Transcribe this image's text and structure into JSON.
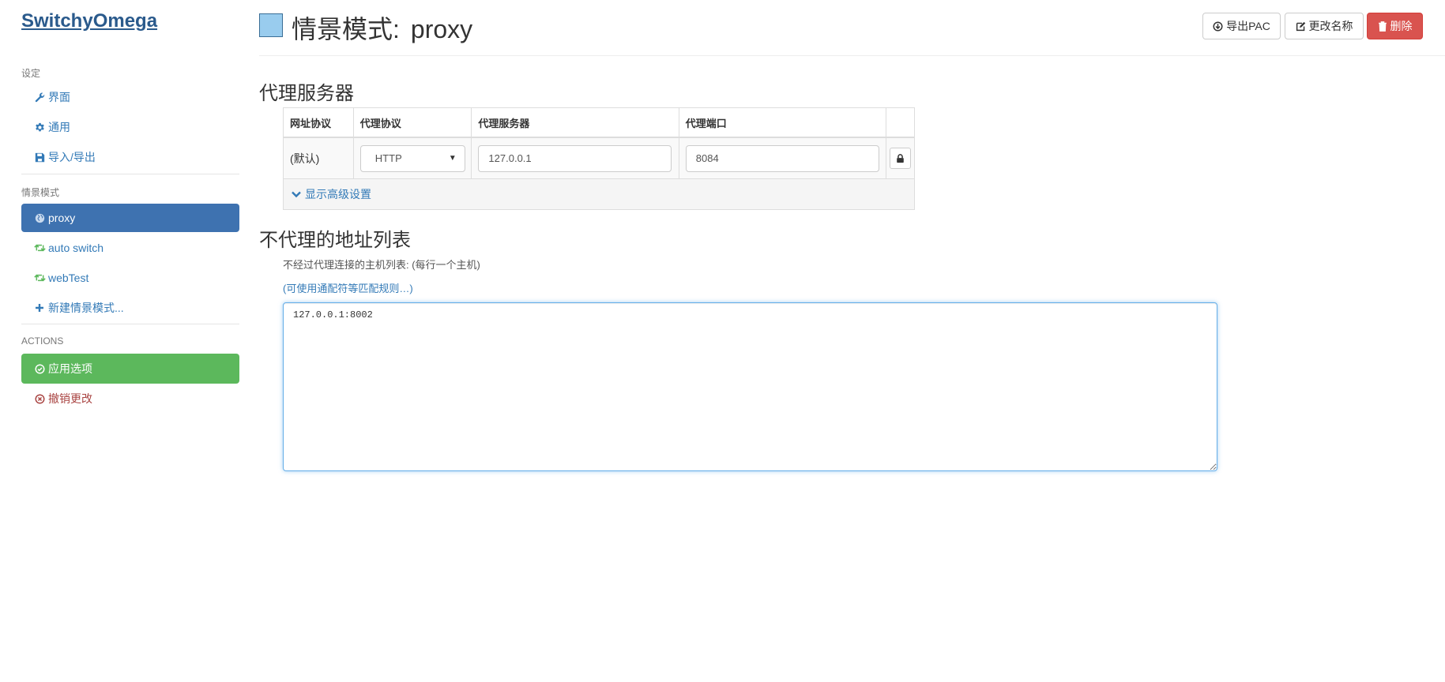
{
  "sidebar": {
    "brand": "SwitchyOmega",
    "settings_header": "设定",
    "settings_items": [
      {
        "label": "界面",
        "icon": "wrench-icon"
      },
      {
        "label": "通用",
        "icon": "gear-icon"
      },
      {
        "label": "导入/导出",
        "icon": "save-icon"
      }
    ],
    "profiles_header": "情景模式",
    "profiles": [
      {
        "label": "proxy",
        "icon": "globe-icon",
        "active": true
      },
      {
        "label": "auto switch",
        "icon": "retweet-icon"
      },
      {
        "label": "webTest",
        "icon": "retweet-icon"
      }
    ],
    "new_profile_label": "新建情景模式...",
    "actions_header": "ACTIONS",
    "apply_label": "应用选项",
    "discard_label": "撤销更改"
  },
  "header": {
    "title_prefix": "情景模式:",
    "profile_name": "proxy",
    "export_pac_label": "导出PAC",
    "rename_label": "更改名称",
    "delete_label": "删除"
  },
  "proxy_servers": {
    "title": "代理服务器",
    "columns": [
      "网址协议",
      "代理协议",
      "代理服务器",
      "代理端口"
    ],
    "rows": [
      {
        "scheme": "(默认)",
        "protocol": "HTTP",
        "server": "127.0.0.1",
        "port": "8084"
      }
    ],
    "advanced_label": "显示高级设置"
  },
  "bypass": {
    "title": "不代理的地址列表",
    "help": "不经过代理连接的主机列表: (每行一个主机)",
    "rules_link": "(可使用通配符等匹配规则…)",
    "value": "127.0.0.1:8002"
  },
  "colors": {
    "brand": "#2a5a8c",
    "link": "#337ab7",
    "active": "#3e72b0",
    "success": "#5cb85c",
    "danger": "#d9534f",
    "profile_swatch": "#99ccee"
  }
}
